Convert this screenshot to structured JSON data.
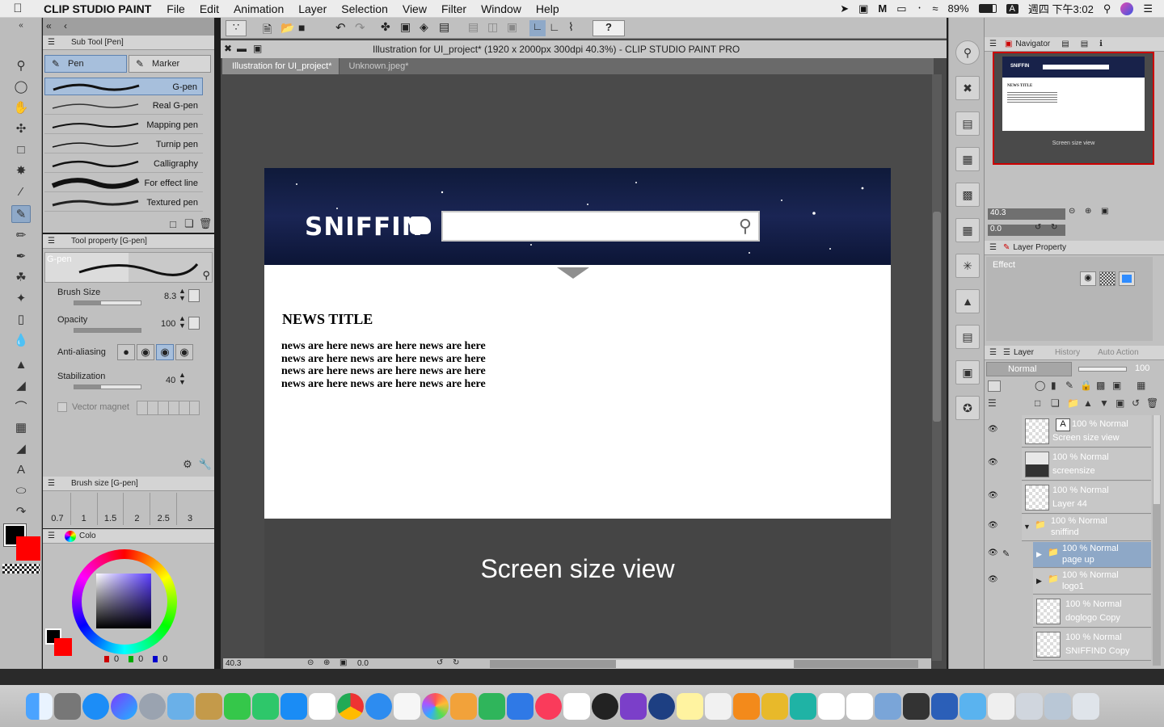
{
  "menubar": {
    "app_name": "CLIP STUDIO PAINT",
    "items": [
      "File",
      "Edit",
      "Animation",
      "Layer",
      "Selection",
      "View",
      "Filter",
      "Window",
      "Help"
    ],
    "battery": "89%",
    "input_method": "A",
    "datetime": "週四 下午3:02"
  },
  "window": {
    "title": "Illustration for UI_project* (1920 x 2000px 300dpi 40.3%)  - CLIP STUDIO PAINT PRO",
    "tabs": [
      "Illustration for UI_project*",
      "Unknown.jpeg*"
    ]
  },
  "subtool": {
    "header": "Sub Tool [Pen]",
    "tabs": [
      "Pen",
      "Marker"
    ],
    "brushes": [
      "G-pen",
      "Real G-pen",
      "Mapping pen",
      "Turnip pen",
      "Calligraphy",
      "For effect line",
      "Textured pen"
    ]
  },
  "tool_property": {
    "header": "Tool property [G-pen]",
    "preview_label": "G-pen",
    "brush_size_label": "Brush Size",
    "brush_size_value": "8.3",
    "opacity_label": "Opacity",
    "opacity_value": "100",
    "antialiasing_label": "Anti-aliasing",
    "stabilization_label": "Stabilization",
    "stabilization_value": "40",
    "vector_magnet_label": "Vector magnet"
  },
  "brush_size_panel": {
    "header": "Brush size [G-pen]",
    "sizes": [
      "0.7",
      "1",
      "1.5",
      "2",
      "2.5",
      "3"
    ]
  },
  "color_panel": {
    "tab_label": "Colo",
    "r": "0",
    "g": "0",
    "b": "0"
  },
  "canvas": {
    "logo": "SNIFFIN",
    "news_title": "NEWS TITLE",
    "news_lines": [
      "news are here news are here news are here",
      "news are here news are here news are here",
      "news are here news are here news are here",
      "news are here news are here news are here"
    ],
    "screen_size_view": "Screen size view",
    "zoom": "40.3",
    "rotation": "0.0"
  },
  "navigator": {
    "tab": "Navigator",
    "zoom": "40.3",
    "rotation": "0.0",
    "mini_caption": "Screen size view",
    "mini_logo": "SNIFFIN",
    "mini_title": "NEWS TITLE"
  },
  "layer_property": {
    "tab": "Layer Property",
    "effect_label": "Effect"
  },
  "layer_panel": {
    "tabs": [
      "Layer",
      "History",
      "Auto Action"
    ],
    "blend_mode": "Normal",
    "opacity": "100",
    "layers": [
      {
        "mode": "100 % Normal",
        "name": "Screen size view"
      },
      {
        "mode": "100 % Normal",
        "name": "screensize"
      },
      {
        "mode": "100 % Normal",
        "name": "Layer 44"
      },
      {
        "mode": "100 % Normal",
        "name": "sniffind"
      },
      {
        "mode": "100 % Normal",
        "name": "page up"
      },
      {
        "mode": "100 % Normal",
        "name": "logo1"
      },
      {
        "mode": "100 % Normal",
        "name": "doglogo Copy"
      },
      {
        "mode": "100 % Normal",
        "name": "SNIFFIND Copy"
      }
    ]
  },
  "colors": {
    "accent_blue": "#8fa9c8",
    "main_color": "#000000",
    "sub_color": "#ff0000",
    "hero_bg": "#13204a"
  }
}
